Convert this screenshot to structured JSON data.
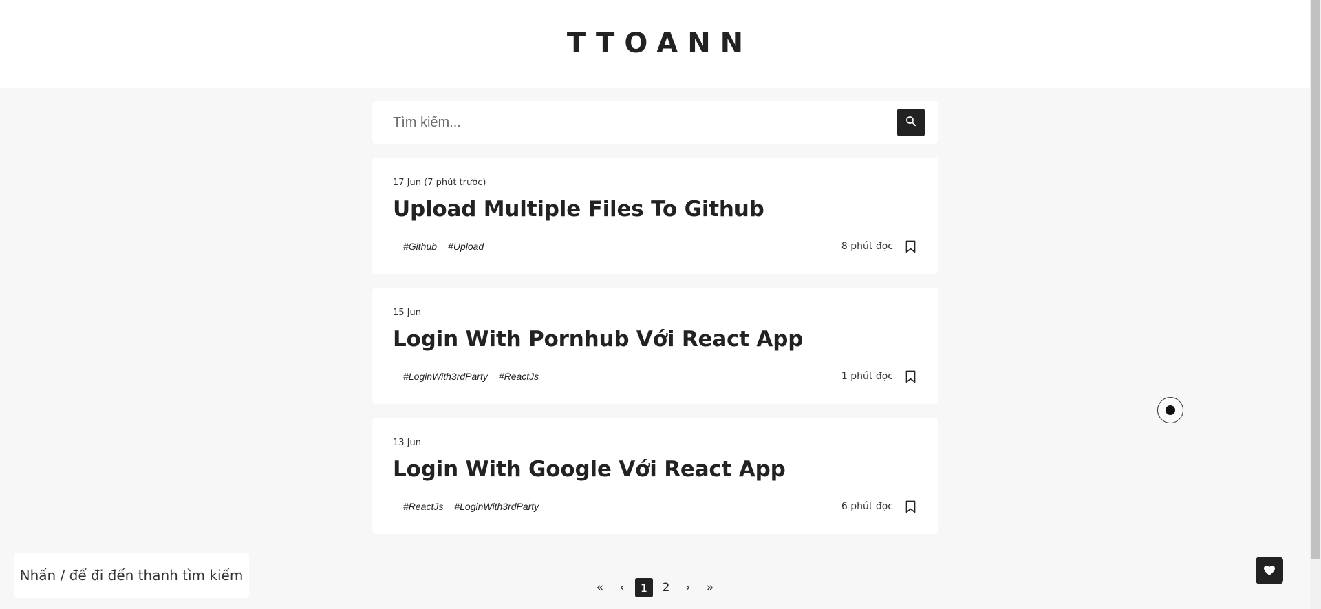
{
  "site": {
    "logo": "TTOANN"
  },
  "search": {
    "placeholder": "Tìm kiếm..."
  },
  "posts": [
    {
      "date": "17 Jun (7 phút trước)",
      "title": "Upload Multiple Files To Github",
      "tags": [
        "#Github",
        "#Upload"
      ],
      "read_time": "8 phút đọc"
    },
    {
      "date": "15 Jun",
      "title": "Login With Pornhub Với React App",
      "tags": [
        "#LoginWith3rdParty",
        "#ReactJs"
      ],
      "read_time": "1 phút đọc"
    },
    {
      "date": "13 Jun",
      "title": "Login With Google Với React App",
      "tags": [
        "#ReactJs",
        "#LoginWith3rdParty"
      ],
      "read_time": "6 phút đọc"
    }
  ],
  "pagination": {
    "first": "«",
    "prev": "‹",
    "pages": [
      "1",
      "2"
    ],
    "current": "1",
    "next": "›",
    "last": "»"
  },
  "hint": {
    "text": "Nhấn / để đi đến thanh tìm kiếm"
  },
  "icons": {
    "search": "search-icon",
    "bookmark": "bookmark-icon",
    "heart": "heart-icon"
  },
  "colors": {
    "accent": "#222222",
    "background": "#f7f7f7",
    "card": "#ffffff"
  }
}
